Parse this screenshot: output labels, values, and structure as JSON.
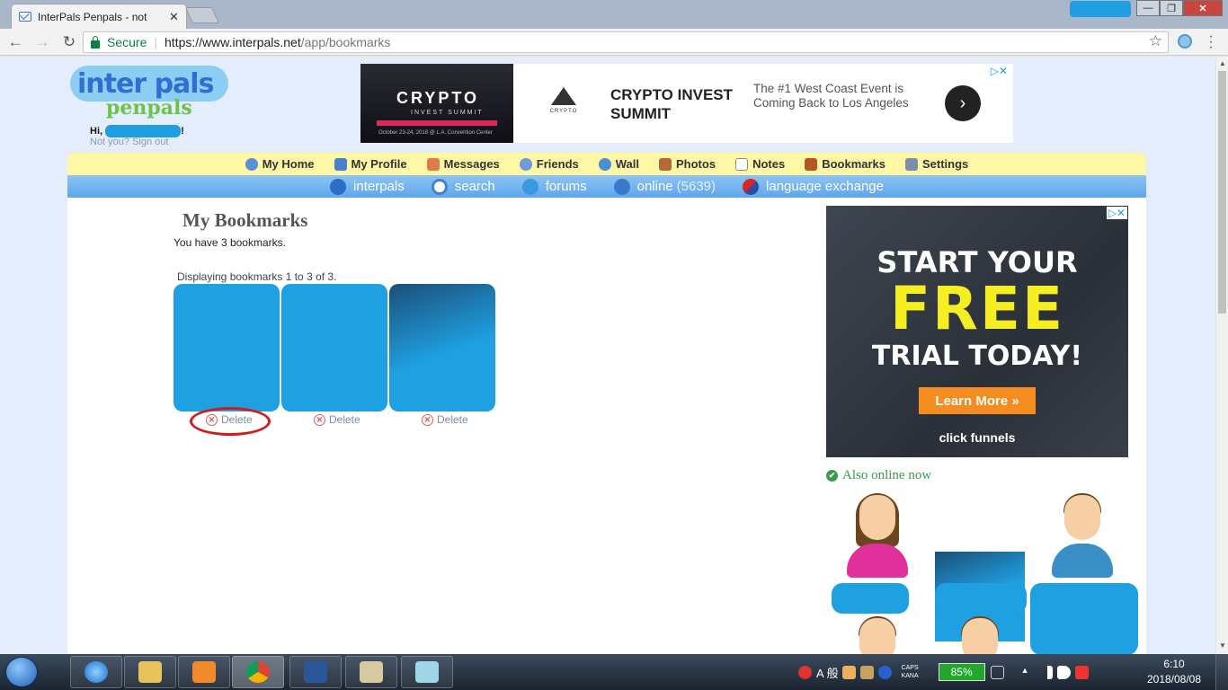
{
  "browser": {
    "tab_title": "InterPals Penpals - not",
    "tab_close": "✕",
    "secure_label": "Secure",
    "url_host": "https://www.interpals.net",
    "url_path": "/app/bookmarks",
    "window_minimize": "—",
    "window_maximize": "❐",
    "window_close": "✕"
  },
  "site": {
    "logo_top": "inter pals",
    "logo_bottom": "penpals",
    "greeting_prefix": "Hi,",
    "greeting_suffix": "!",
    "signout_text": "Not you? Sign out"
  },
  "top_ad": {
    "image_title": "CRYPTO",
    "image_sub": "INVEST SUMMIT",
    "image_date": "October 23-24, 2018 @ L.A. Convention Center",
    "logo_text": "CRYPTO",
    "headline": "CRYPTO INVEST SUMMIT",
    "description": "The #1 West Coast Event is Coming Back to Los Angeles",
    "next_glyph": "›",
    "adchoice": "▷✕"
  },
  "nav_primary": [
    {
      "label": "My Home",
      "icon_color": "#5b8fd6"
    },
    {
      "label": "My Profile",
      "icon_color": "#4a7fcc"
    },
    {
      "label": "Messages",
      "icon_color": "#e07a4a"
    },
    {
      "label": "Friends",
      "icon_color": "#6c9bd8"
    },
    {
      "label": "Wall",
      "icon_color": "#4a8fd6"
    },
    {
      "label": "Photos",
      "icon_color": "#b36a3a"
    },
    {
      "label": "Notes",
      "icon_color": "#8a8a8a"
    },
    {
      "label": "Bookmarks",
      "icon_color": "#b3572a"
    },
    {
      "label": "Settings",
      "icon_color": "#7a8fa8"
    }
  ],
  "nav_secondary": {
    "interpals": "interpals",
    "search": "search",
    "forums": "forums",
    "online": "online",
    "online_count": "(5639)",
    "language_exchange": "language exchange"
  },
  "main": {
    "title": "My Bookmarks",
    "count_text": "You have 3 bookmarks.",
    "display_text": "Displaying bookmarks 1 to 3 of 3.",
    "delete_label": "Delete",
    "delete_glyph": "✕"
  },
  "side_ad": {
    "line1": "START YOUR",
    "line2": "FREE",
    "line3": "TRIAL TODAY!",
    "button": "Learn More »",
    "brand": "click funnels",
    "adchoice": "▷✕"
  },
  "online": {
    "title": "Also online now",
    "check_glyph": "✔"
  },
  "taskbar": {
    "ime_text": "A 般",
    "caps_line1": "CAPS",
    "caps_line2": "KANA",
    "battery": "85%",
    "time": "6:10",
    "date": "2018/08/08"
  }
}
